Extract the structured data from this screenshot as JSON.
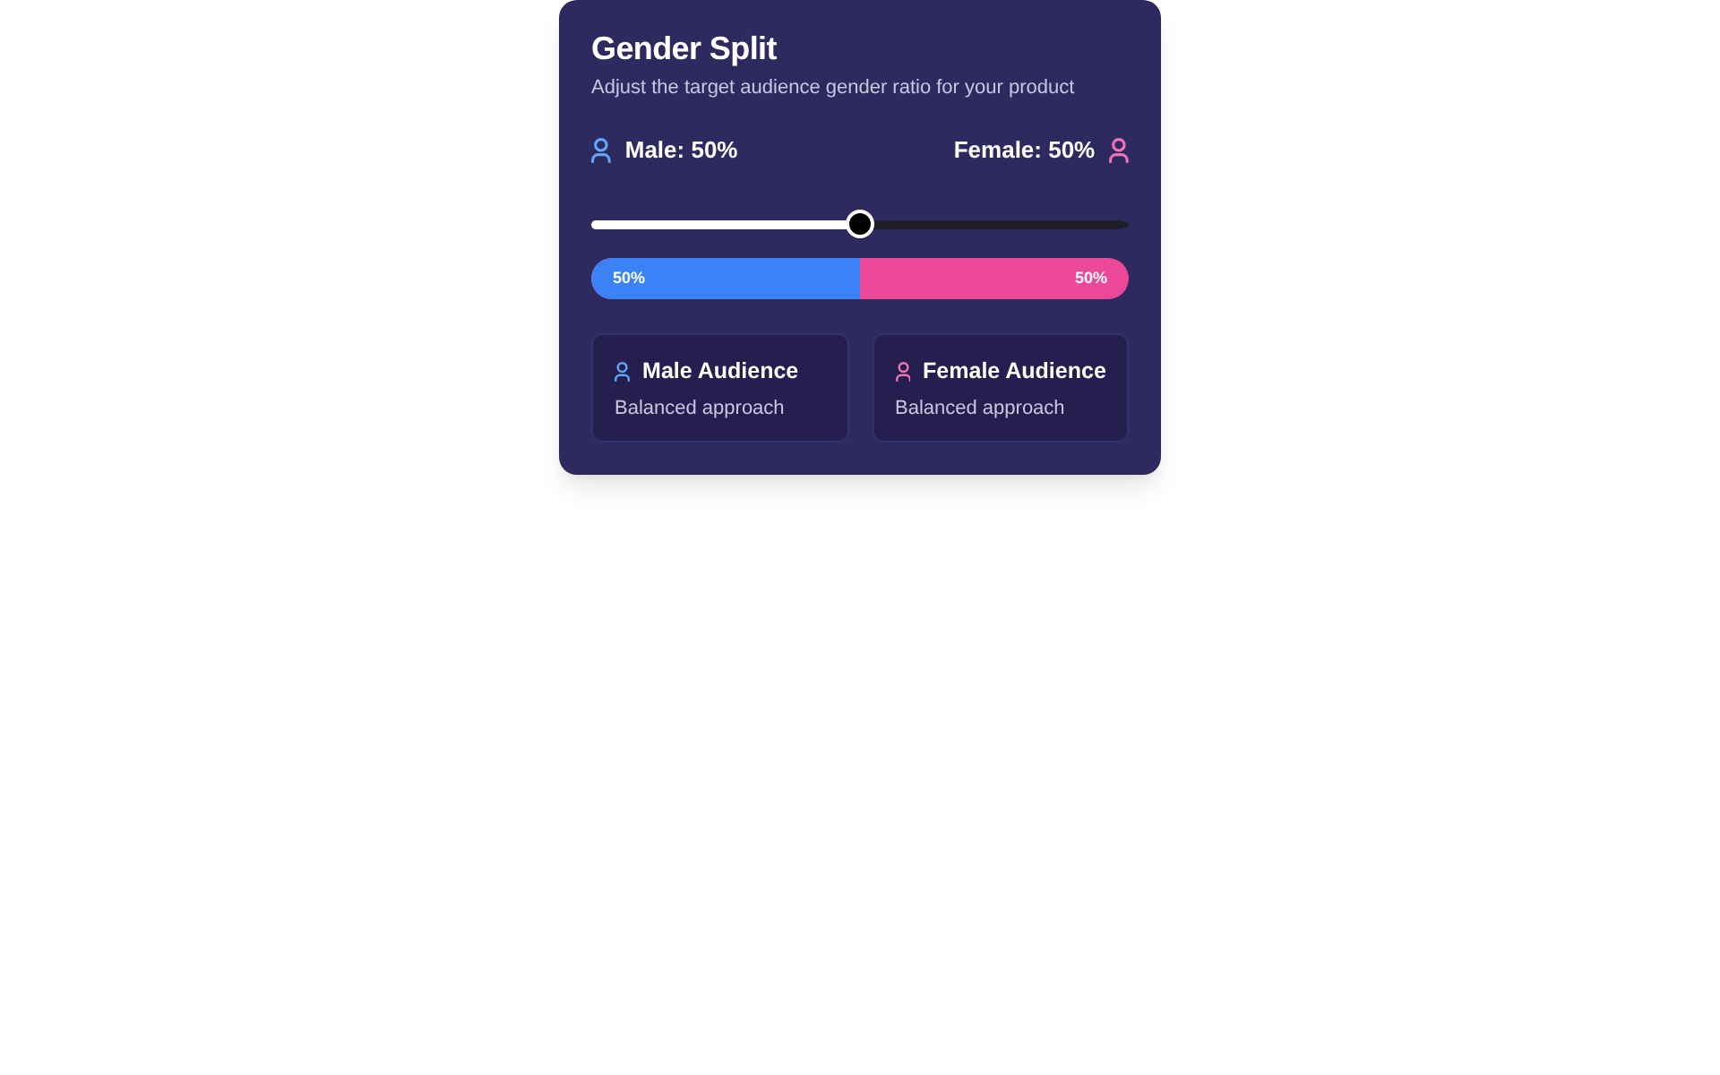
{
  "card": {
    "title": "Gender Split",
    "subtitle": "Adjust the target audience gender ratio for your product"
  },
  "ratio_labels": [
    {
      "text": "Male: 50%",
      "kind": "leading",
      "color": "#60a5fa"
    },
    {
      "text": "Female: 50%",
      "kind": "trailing",
      "color": "#f472b6"
    }
  ],
  "slider": {
    "level": 0.5
  },
  "split_bar": {
    "level": 0.5,
    "labels": [
      "50%",
      "50%"
    ]
  },
  "audience_cards": [
    {
      "title": "Male Audience",
      "description": "Balanced approach",
      "color": "#60a5fa"
    },
    {
      "title": "Female Audience",
      "description": "Balanced approach",
      "color": "#f472b6"
    }
  ]
}
